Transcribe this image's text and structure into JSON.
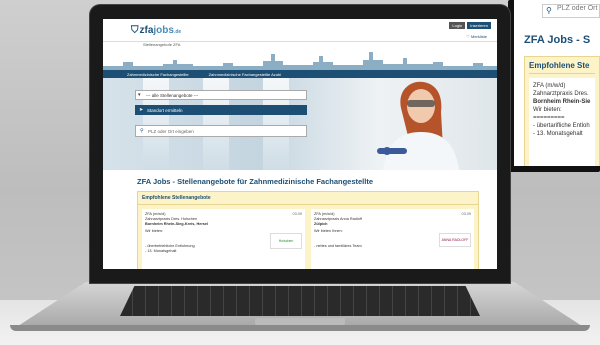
{
  "site": {
    "login": "Login",
    "register": "Inserieren",
    "logo_zfa": "zfa",
    "logo_jobs": "jobs",
    "logo_tld": ".de",
    "tagline": "Stellenangebote ZFA",
    "merkliste": "Merkliste",
    "nav": [
      "Zahnmedizinische Fachangestellte",
      "Zahnmedizinische Fachangestellte Azubi"
    ],
    "search": {
      "select_label": "--- alle Stellenangebote ---",
      "locate_button": "Standort ermitteln",
      "plz_placeholder": "PLZ oder Ort eingeben"
    },
    "page_title": "ZFA Jobs - Stellenangebote für Zahnmedizinische Fachangestellte",
    "featured_heading": "Empfohlene Stellenangebote",
    "cards": [
      {
        "date": "03.09",
        "title": "ZFA (m/w/d)",
        "practice": "Zahnarztpraxis Dres. Hoischen",
        "location": "Bornheim Rhein-Sieg-Kreis, Hersel",
        "offer_heading": "Wir bieten:",
        "bullet1": "- überbetriebliche Entlohnung",
        "bullet2": "- 13. Monatsgehalt",
        "logo_text": "Hoischen"
      },
      {
        "date": "03.09",
        "title": "ZFA (m/w/d)",
        "practice": "Zahnarztpraxis Anna Radloff",
        "location": "Zülpich",
        "offer_heading": "Wir bieten Ihnen:",
        "bullet1": "- nettes und familiäres Team",
        "bullet2": "",
        "logo_text": "ANNA RADLOFF"
      }
    ]
  },
  "monitor": {
    "plz_placeholder": "PLZ oder Ort",
    "title": "ZFA Jobs - S",
    "box_heading": "Empfohlene Ste",
    "card_title": "ZFA (m/w/d)",
    "card_practice": "Zahnarztpraxis Dres.",
    "card_location": "Bornheim Rhein-Sie",
    "card_offer": "Wir bieten:",
    "card_sep": "=========",
    "card_bullet1": "- übertarifliche Entloh",
    "card_bullet2": "- 13. Monatsgehalt"
  },
  "colors": {
    "brand": "#1d4f75",
    "featured_bg": "#fcf3c8"
  }
}
